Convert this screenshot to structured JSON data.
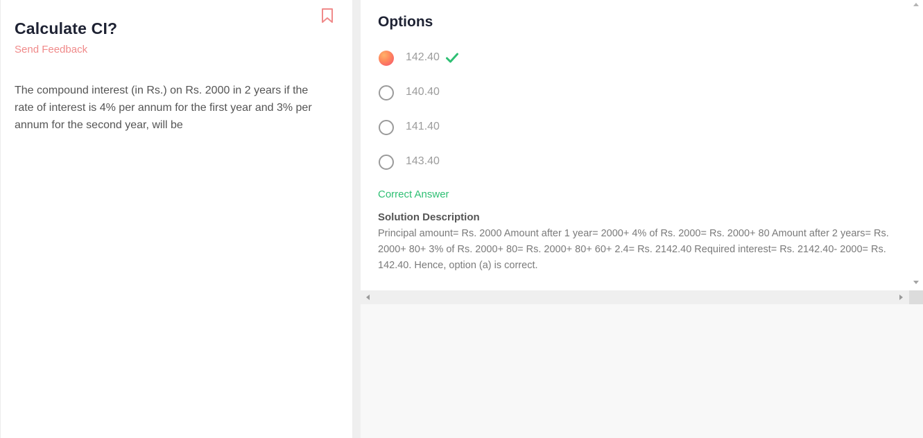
{
  "question": {
    "title": "Calculate CI?",
    "feedback_link": "Send Feedback",
    "text": "The compound interest (in Rs.) on Rs. 2000 in 2 years if the rate of interest is 4% per annum for the first year and 3% per annum for the second year, will be"
  },
  "options": {
    "heading": "Options",
    "items": [
      {
        "label": "142.40",
        "selected": true,
        "correct": true
      },
      {
        "label": "140.40",
        "selected": false,
        "correct": false
      },
      {
        "label": "141.40",
        "selected": false,
        "correct": false
      },
      {
        "label": "143.40",
        "selected": false,
        "correct": false
      }
    ]
  },
  "result": {
    "status": "Correct Answer",
    "solution_title": "Solution Description",
    "solution_text": "Principal amount= Rs. 2000 Amount after 1 year= 2000+ 4% of Rs. 2000= Rs. 2000+ 80 Amount after 2 years= Rs. 2000+ 80+ 3% of Rs. 2000+ 80= Rs. 2000+ 80+ 60+ 2.4= Rs. 2142.40 Required interest= Rs. 2142.40- 2000= Rs. 142.40. Hence, option (a) is correct."
  },
  "colors": {
    "accent": "#f08a8a",
    "success": "#2ebf73",
    "heading": "#1e2233"
  },
  "icons": {
    "bookmark": "bookmark-icon",
    "check": "check-icon"
  }
}
